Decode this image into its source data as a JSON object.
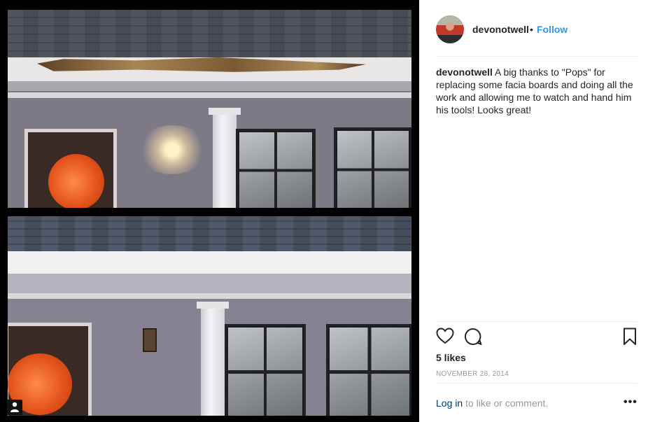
{
  "post": {
    "username": "devonotwell",
    "separator": "•",
    "follow_label": "Follow",
    "caption_user": "devonotwell",
    "caption_text": "A big thanks to \"Pops\" for replacing some facia boards and doing all the work and allowing me to watch and hand him his tools! Looks great!",
    "likes": "5 likes",
    "date": "NOVEMBER 28, 2014",
    "login_link": "Log in",
    "login_suffix": " to like or comment.",
    "more_label": "•••"
  },
  "icons": {
    "like": "heart-icon",
    "comment": "comment-icon",
    "save": "bookmark-icon",
    "tagged": "user-tag-icon"
  },
  "colors": {
    "follow": "#3897f0",
    "login": "#003569",
    "muted": "#999999",
    "text": "#262626"
  }
}
